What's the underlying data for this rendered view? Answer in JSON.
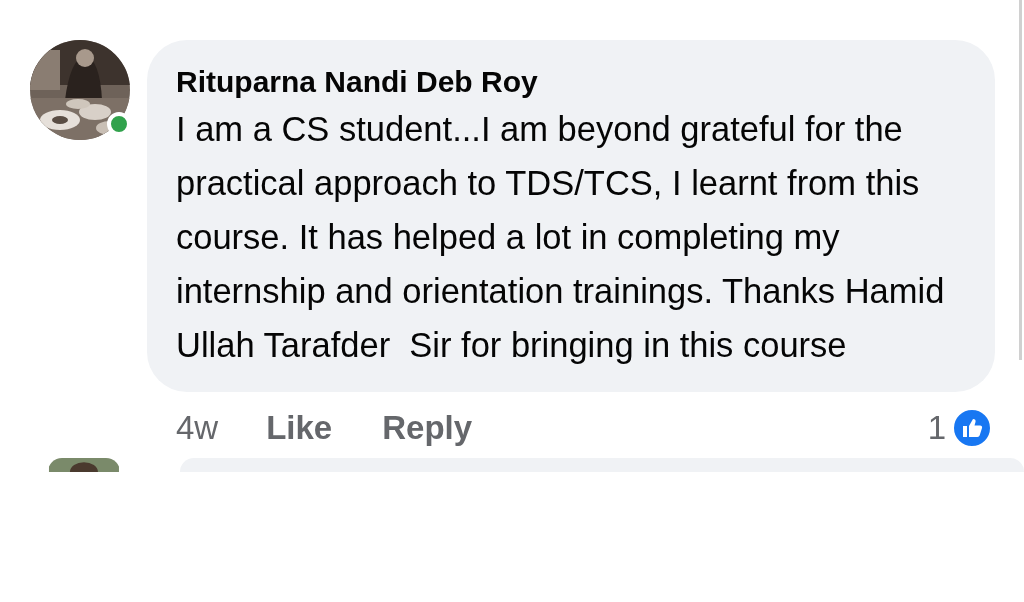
{
  "comments": [
    {
      "author": "Rituparna Nandi Deb Roy",
      "online": true,
      "text": "I am a CS student...I am beyond grateful for the practical approach to TDS/TCS, I learnt from this course. It has helped a lot in completing my internship and orientation trainings. Thanks Hamid Ullah Tarafder  Sir for bringing in this course",
      "time": "4w",
      "actions": [
        "Like",
        "Reply"
      ],
      "reaction_count": "1"
    }
  ]
}
